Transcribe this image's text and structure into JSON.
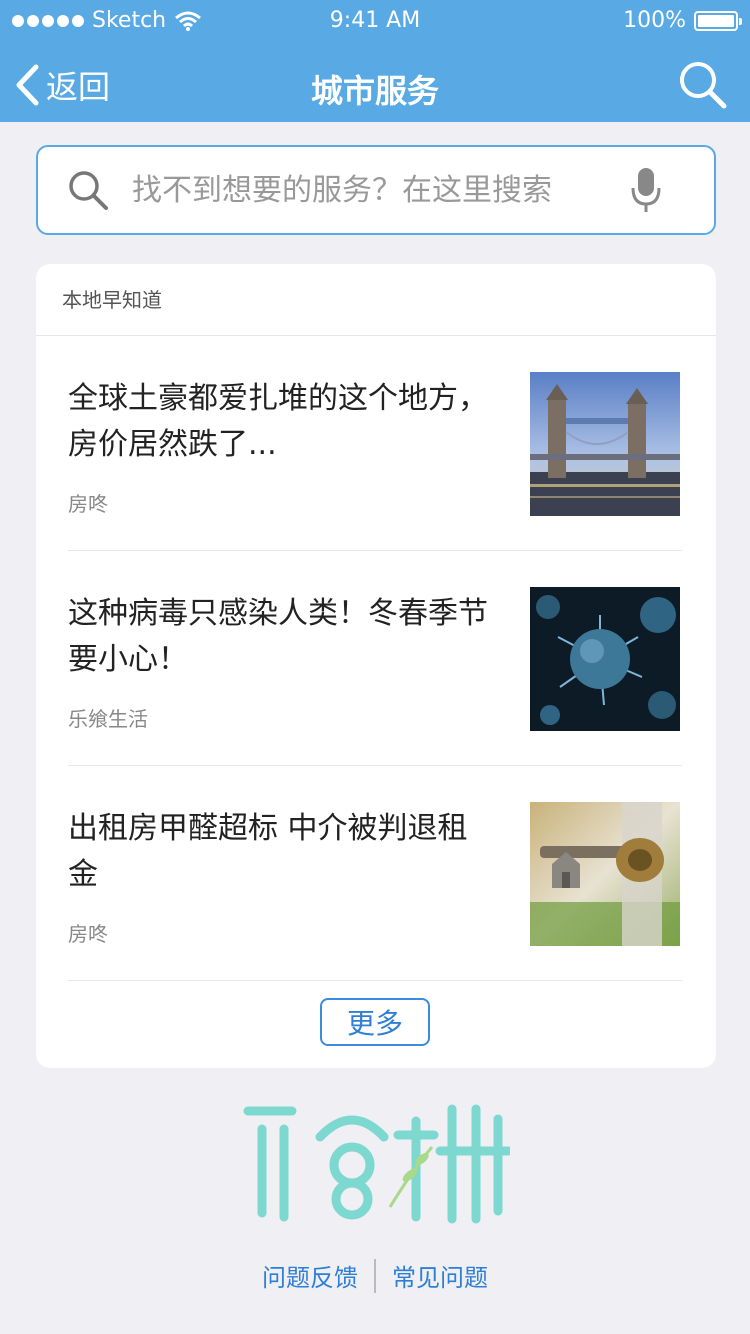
{
  "status_bar": {
    "carrier": "Sketch",
    "time": "9:41 AM",
    "battery": "100%"
  },
  "nav": {
    "back_label": "返回",
    "title": "城市服务"
  },
  "search": {
    "placeholder": "找不到想要的服务？在这里搜索"
  },
  "section": {
    "title": "本地早知道",
    "items": [
      {
        "title": "全球土豪都爱扎堆的这个地方，房价居然跌了...",
        "source": "房咚",
        "thumb": "bridge-photo"
      },
      {
        "title": "这种病毒只感染人类！冬春季节要小心！",
        "source": "乐飨生活",
        "thumb": "virus-photo"
      },
      {
        "title": "出租房甲醛超标 中介被判退租金",
        "source": "房咚",
        "thumb": "key-photo"
      }
    ],
    "more_label": "更多"
  },
  "footer": {
    "feedback": "问题反馈",
    "faq": "常见问题"
  },
  "colors": {
    "primary": "#58a9e4",
    "link": "#2f7fd6",
    "background": "#efeff4",
    "logo": "#7dd8cf"
  }
}
